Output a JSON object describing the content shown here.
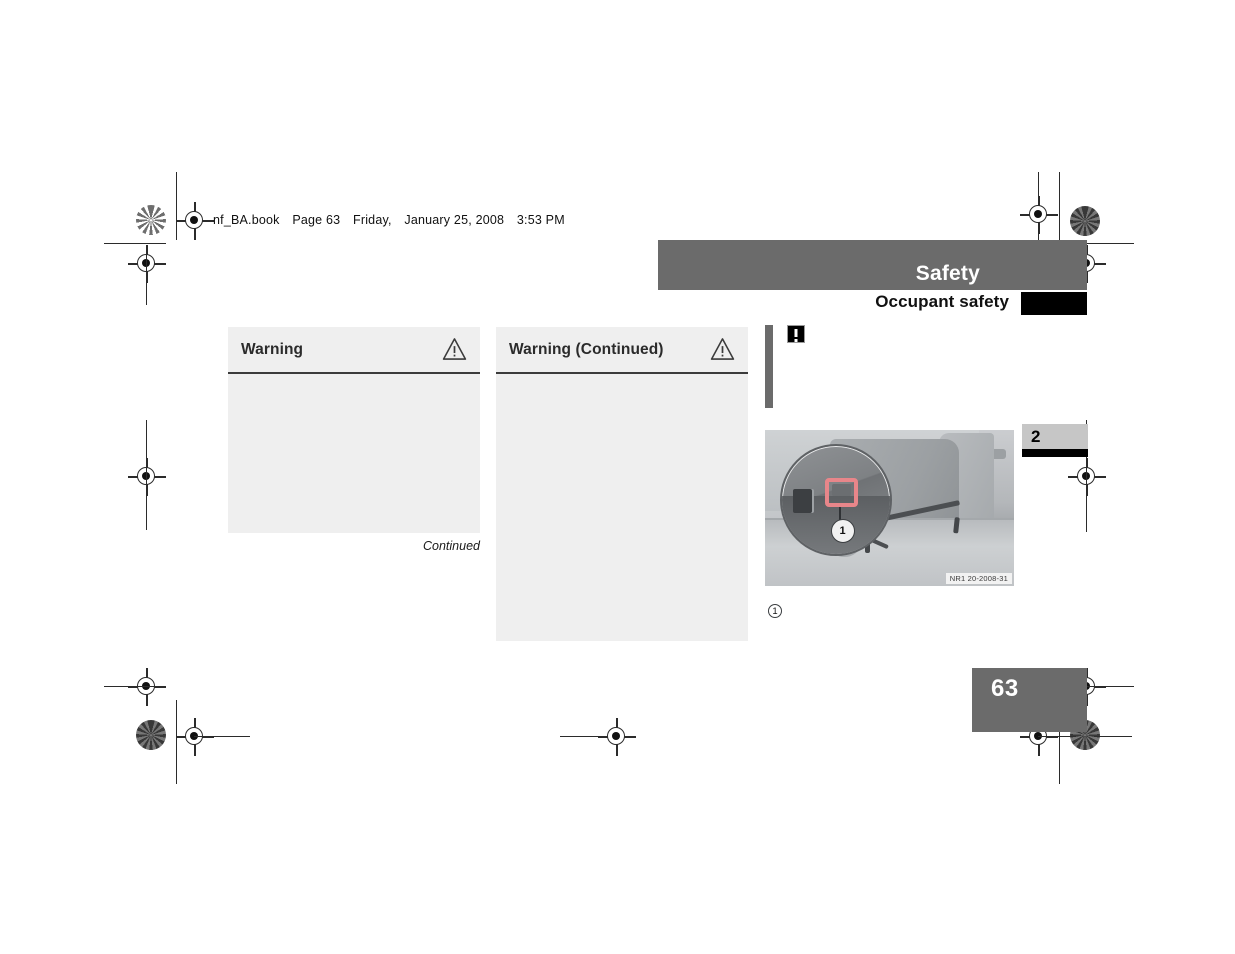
{
  "document": {
    "file_stamp": {
      "filename": "nf_BA.book",
      "page_label": "Page 63",
      "weekday": "Friday,",
      "date": "January 25, 2008",
      "time": "3:53 PM"
    },
    "page_number": "63",
    "chapter_number": "2"
  },
  "banner": {
    "section_title": "Safety",
    "subsection_title": "Occupant safety",
    "banner_color": "#6b6b6b",
    "marker_color": "#000000"
  },
  "warnings": [
    {
      "title": "Warning",
      "icon": "warning-triangle-icon",
      "body": "",
      "footnote": "Continued"
    },
    {
      "title": "Warning (Continued)",
      "icon": "warning-triangle-icon",
      "body": ""
    }
  ],
  "note": {
    "icon": "exclamation-note-icon",
    "body": ""
  },
  "figure": {
    "image_code": "NR1 20-2008-31",
    "callout_number": "1",
    "magnifier_callout": "1",
    "caption": "",
    "alt": "Rear seat bench with magnified inset showing child restraint anchor bracket highlighted in red"
  },
  "legend": {
    "marker": "1",
    "text": ""
  },
  "prepress": {
    "registration_icon": "registration-target-icon",
    "halftone_icon": "halftone-density-patch-icon"
  }
}
